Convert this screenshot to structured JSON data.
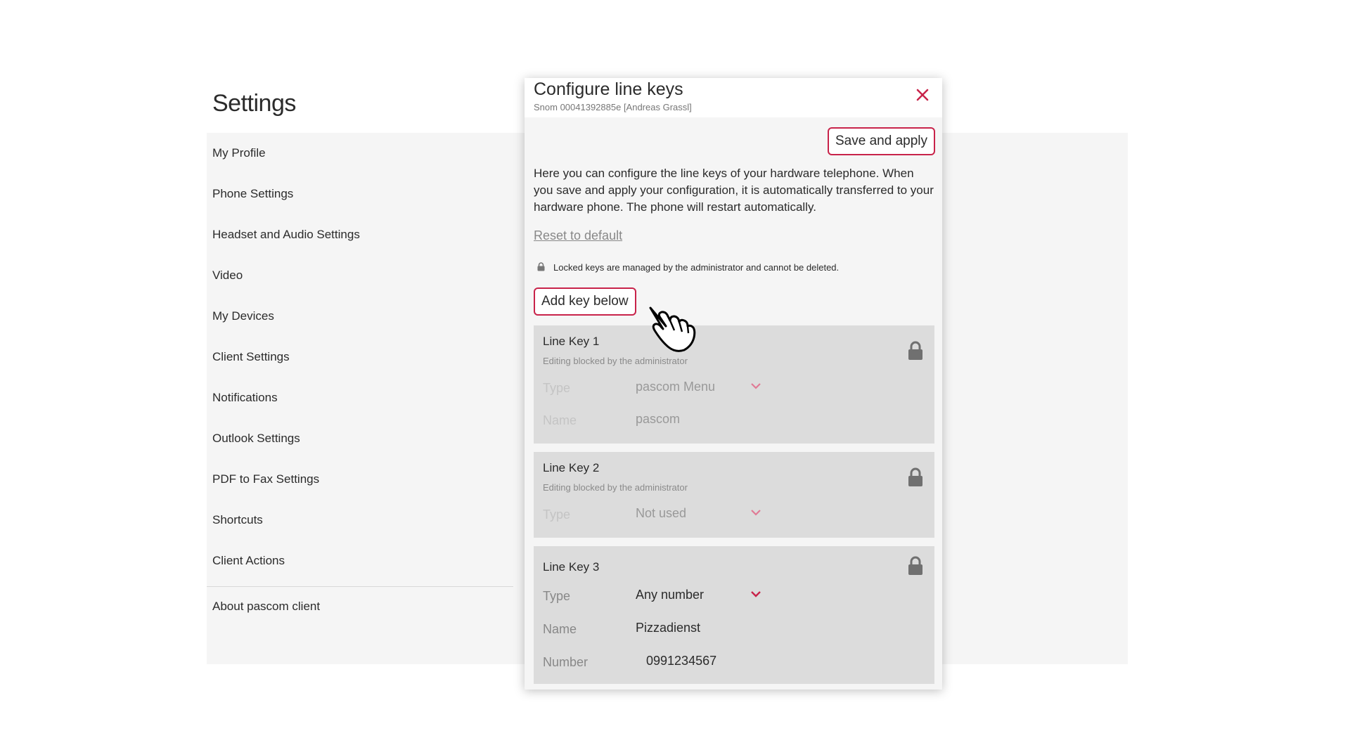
{
  "settings": {
    "title": "Settings",
    "nav": [
      "My Profile",
      "Phone Settings",
      "Headset and Audio Settings",
      "Video",
      "My Devices",
      "Client Settings",
      "Notifications",
      "Outlook Settings",
      "PDF to Fax Settings",
      "Shortcuts",
      "Client Actions"
    ],
    "about": "About pascom client"
  },
  "modal": {
    "title": "Configure line keys",
    "subtitle": "Snom 00041392885e [Andreas Grassl]",
    "save_label": "Save and apply",
    "description": "Here you can configure the line keys of your hardware telephone. When you save and apply your configuration, it is automatically transferred to your hardware phone. The phone will restart automatically.",
    "reset_label": "Reset to default",
    "locked_note": "Locked keys are managed by the administrator and cannot be deleted.",
    "add_key_label": "Add key below",
    "accent_color": "#c8234a",
    "keys": [
      {
        "title": "Line Key 1",
        "sub": "Editing blocked by the administrator",
        "type_label": "Type",
        "type_value": "pascom Menu",
        "name_label": "Name",
        "name_value": "pascom"
      },
      {
        "title": "Line Key 2",
        "sub": "Editing blocked by the administrator",
        "type_label": "Type",
        "type_value": "Not used"
      },
      {
        "title": "Line Key 3",
        "type_label": "Type",
        "type_value": "Any number",
        "name_label": "Name",
        "name_value": "Pizzadienst",
        "number_label": "Number",
        "number_value": "0991234567"
      }
    ]
  }
}
